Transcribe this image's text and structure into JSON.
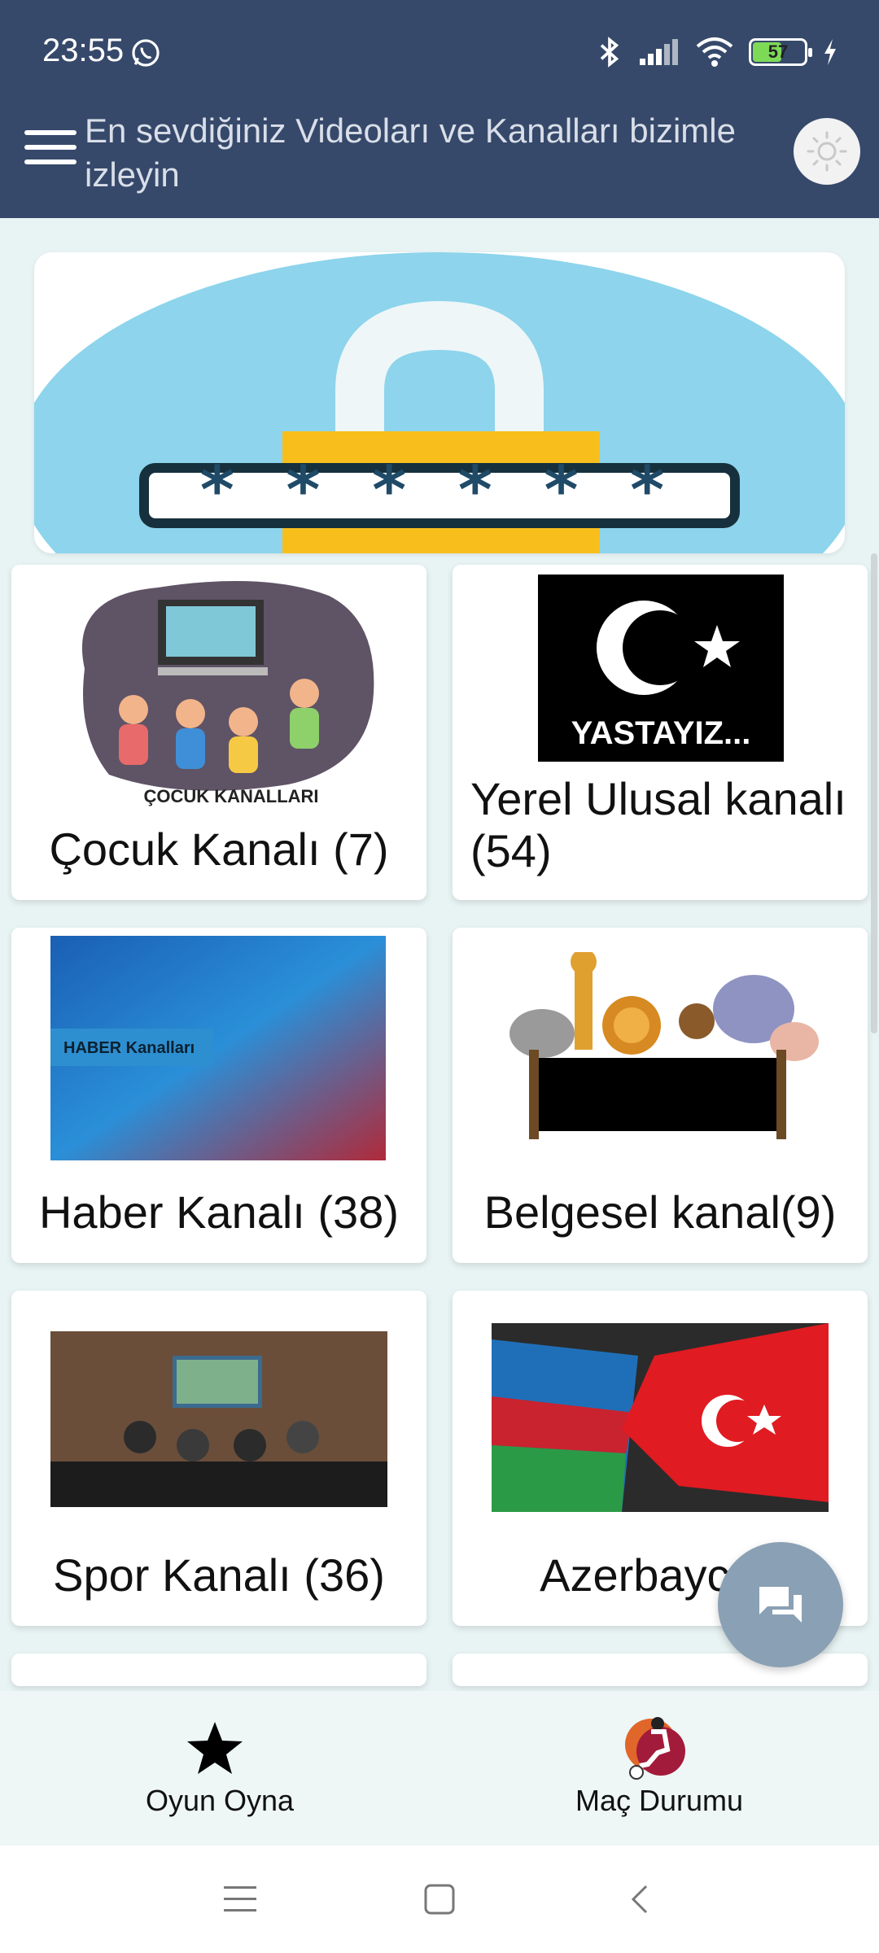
{
  "status_bar": {
    "time": "23:55",
    "battery": "57",
    "battery_level": 0.57,
    "icons": [
      "whatsapp-icon",
      "bluetooth-icon",
      "signal-icon",
      "wifi-icon",
      "battery-icon",
      "charging-icon"
    ]
  },
  "app_bar": {
    "title": "En sevdiğiniz Videoları ve Kanalları bizimle izleyin",
    "menu_icon": "hamburger-icon",
    "theme_icon": "sun-icon"
  },
  "banner": {
    "password_mask": "* * * * * *"
  },
  "categories": [
    {
      "label": "Çocuk Kanalı (7)",
      "thumb_text": "ÇOCUK KANALLARI"
    },
    {
      "label": "Yerel Ulusal kanalı (54)",
      "thumb_text": "YASTAYIZ..."
    },
    {
      "label": "Haber Kanalı (38)",
      "thumb_text": "HABER Kanalları"
    },
    {
      "label": "Belgesel kanal(9)"
    },
    {
      "label": "Spor Kanalı (36)"
    },
    {
      "label": "Azerbaycan"
    }
  ],
  "bottom_nav": [
    {
      "label": "Oyun Oyna",
      "icon": "star-icon"
    },
    {
      "label": "Maç Durumu",
      "icon": "football-player-icon"
    }
  ],
  "fab": {
    "icon": "chat-icon"
  },
  "colors": {
    "app_bar": "#36496b",
    "background": "#e8f3f3",
    "fab": "#8aa0b4"
  }
}
